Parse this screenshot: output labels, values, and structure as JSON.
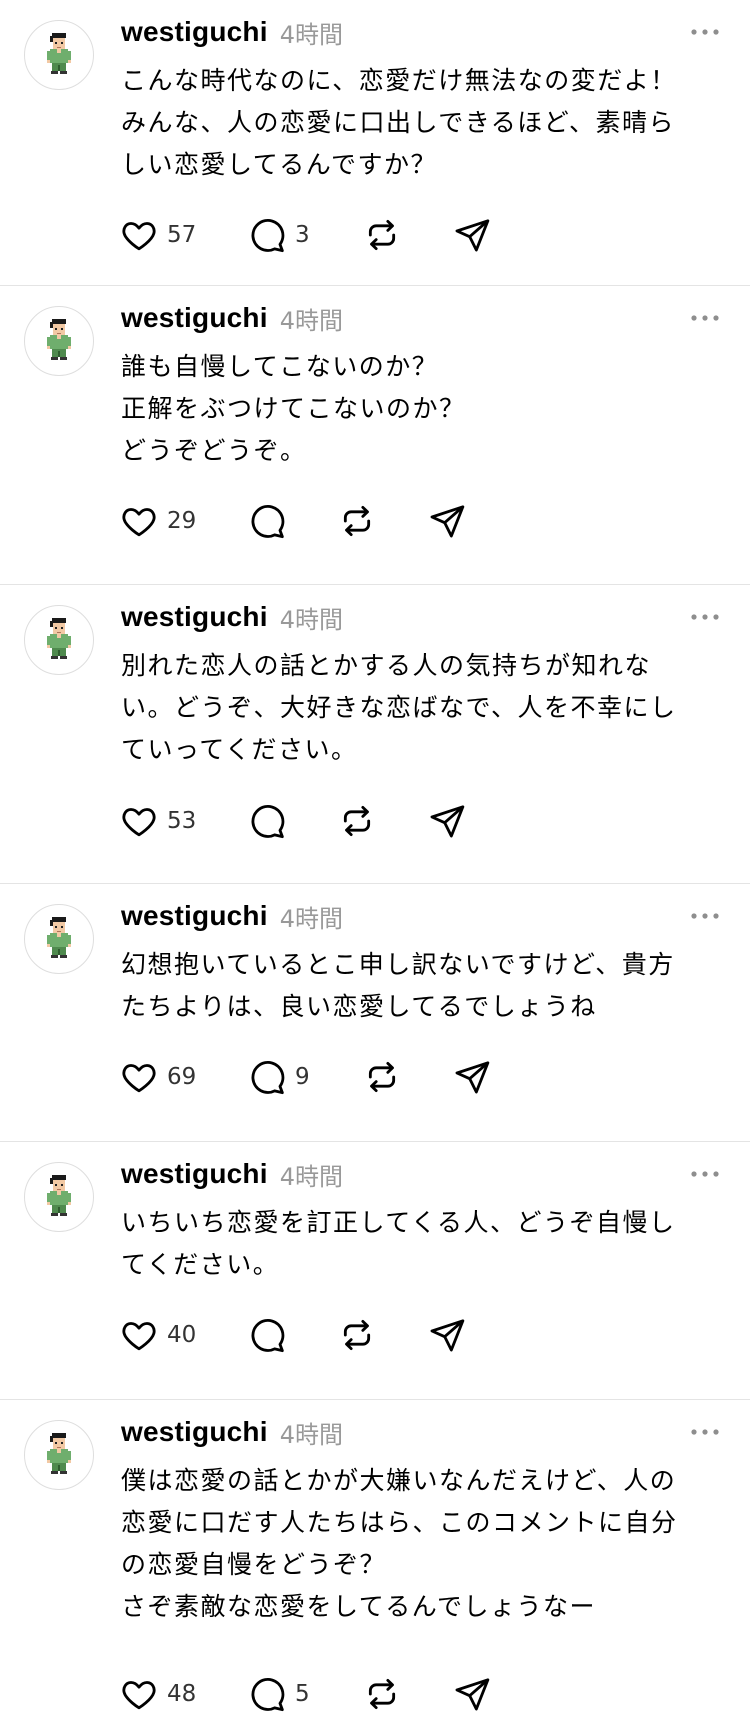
{
  "posts": [
    {
      "username": "westiguchi",
      "time": "4時間",
      "text": "こんな時代なのに、恋愛だけ無法なの変だよ！\nみんな、人の恋愛に口出しできるほど、素晴ら\nしい恋愛してるんですか？",
      "likes": "57",
      "replies": "3"
    },
    {
      "username": "westiguchi",
      "time": "4時間",
      "text": "誰も自慢してこないのか？\n正解をぶつけてこないのか？\nどうぞどうぞ。",
      "likes": "29",
      "replies": ""
    },
    {
      "username": "westiguchi",
      "time": "4時間",
      "text": "別れた恋人の話とかする人の気持ちが知れな\nい。どうぞ、大好きな恋ばなで、人を不幸にし\nていってください。",
      "likes": "53",
      "replies": ""
    },
    {
      "username": "westiguchi",
      "time": "4時間",
      "text": "幻想抱いているとこ申し訳ないですけど、貴方\nたちよりは、良い恋愛してるでしょうね",
      "likes": "69",
      "replies": "9"
    },
    {
      "username": "westiguchi",
      "time": "4時間",
      "text": "いちいち恋愛を訂正してくる人、どうぞ自慢し\nてください。",
      "likes": "40",
      "replies": ""
    },
    {
      "username": "westiguchi",
      "time": "4時間",
      "text": "僕は恋愛の話とかが大嫌いなんだえけど、人の\n恋愛に口だす人たちはら、このコメントに自分\nの恋愛自慢をどうぞ？\nさぞ素敵な恋愛をしてるんでしょうなー",
      "likes": "48",
      "replies": "5"
    }
  ],
  "icons": {
    "like": "heart-icon",
    "reply": "comment-bubble-icon",
    "repost": "repost-icon",
    "share": "paper-plane-icon",
    "more": "more-dots-icon"
  },
  "colors": {
    "text": "#000000",
    "muted": "#999999",
    "icon": "#000000",
    "divider": "#e4e4e4"
  }
}
